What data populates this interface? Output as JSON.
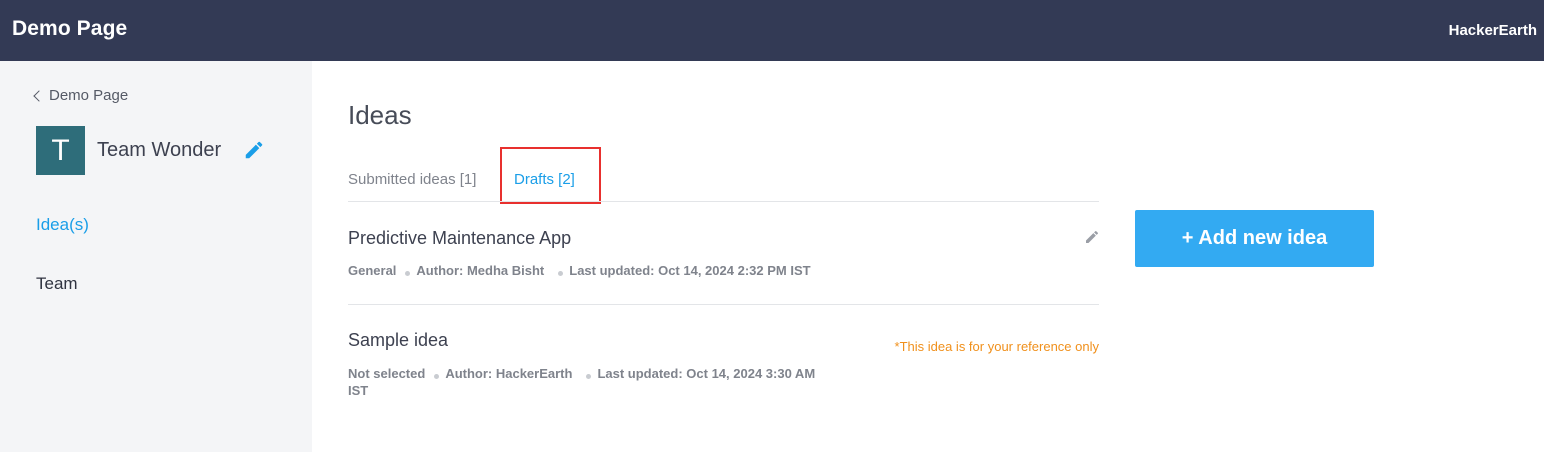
{
  "header": {
    "title": "Demo Page",
    "org_name": "HackerEarth"
  },
  "sidebar": {
    "back_label": "Demo Page",
    "avatar_letter": "T",
    "team_name": "Team Wonder",
    "nav": [
      {
        "label": "Idea(s)",
        "active": true
      },
      {
        "label": "Team",
        "active": false
      }
    ]
  },
  "main": {
    "title": "Ideas",
    "tabs": [
      {
        "label": "Submitted ideas [1]",
        "active": false
      },
      {
        "label": "Drafts [2]",
        "active": true
      }
    ],
    "ideas": [
      {
        "title": "Predictive Maintenance App",
        "category": "General",
        "author": "Author: Medha Bisht",
        "updated": "Last updated: Oct 14, 2024 2:32 PM IST"
      },
      {
        "title": "Sample idea",
        "category": "Not selected",
        "author": "Author: HackerEarth",
        "updated": "Last updated: Oct 14, 2024 3:30 AM",
        "updated_cont": "IST",
        "note": "*This idea is for your reference only"
      }
    ],
    "add_button_label": "+ Add new idea"
  },
  "colors": {
    "header_bg": "#333a55",
    "accent": "#1a9ee8",
    "button_bg": "#33aaf2",
    "highlight_border": "#e8302e",
    "note_color": "#f0901c",
    "avatar_bg": "#2e6d7a"
  },
  "icons": {
    "back": "chevron-left-icon",
    "edit_team": "pencil-icon",
    "edit_idea": "pencil-icon"
  }
}
